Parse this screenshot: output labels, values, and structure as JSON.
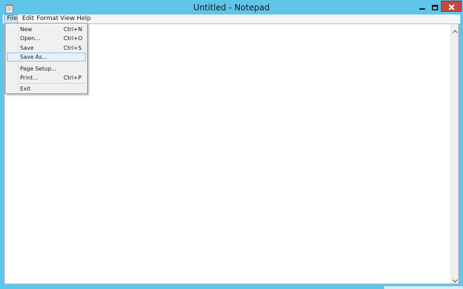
{
  "window": {
    "title": "Untitled - Notepad",
    "accent_color": "#5fc5ea",
    "close_color": "#c7483d",
    "icons": {
      "app": "notepad-icon",
      "minimize": "minimize-icon",
      "maximize": "maximize-icon",
      "close": "close-icon"
    }
  },
  "menubar": {
    "items": [
      {
        "label": "File",
        "active": true
      },
      {
        "label": "Edit"
      },
      {
        "label": "Format"
      },
      {
        "label": "View"
      },
      {
        "label": "Help"
      }
    ]
  },
  "file_menu": {
    "items": [
      {
        "label": "New",
        "shortcut": "Ctrl+N"
      },
      {
        "label": "Open...",
        "shortcut": "Ctrl+O"
      },
      {
        "label": "Save",
        "shortcut": "Ctrl+S"
      },
      {
        "label": "Save As...",
        "shortcut": "",
        "highlighted": true
      },
      {
        "label": "Page Setup...",
        "shortcut": ""
      },
      {
        "label": "Print...",
        "shortcut": "Ctrl+P"
      },
      {
        "label": "Exit",
        "shortcut": ""
      }
    ]
  },
  "editor": {
    "content": ""
  }
}
